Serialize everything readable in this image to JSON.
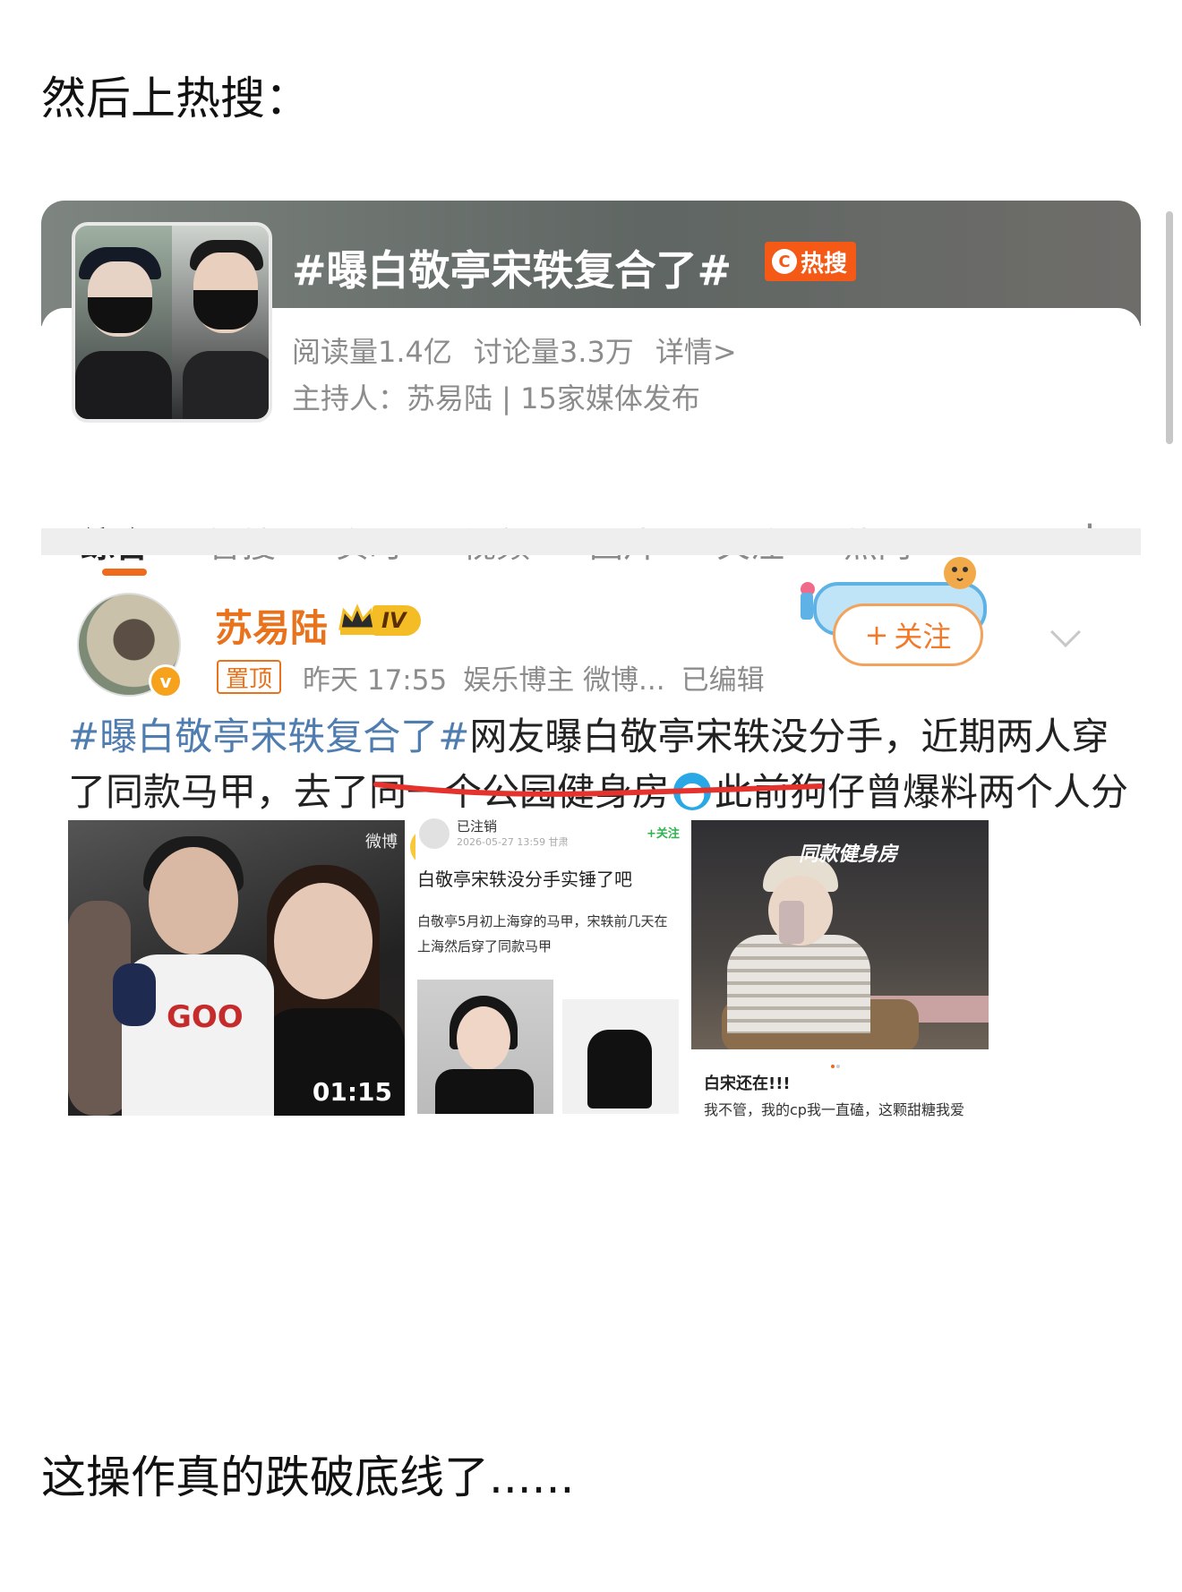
{
  "captions": {
    "top": "然后上热搜：",
    "bottom": "这操作真的跌破底线了......"
  },
  "topic": {
    "title": "#曝白敬亭宋轶复合了#",
    "hot_label": "热搜",
    "reads": "阅读量1.4亿",
    "discussions": "讨论量3.3万",
    "details_link": "详情>",
    "host_line": "主持人：苏易陆 | 15家媒体发布"
  },
  "tabs": [
    {
      "label": "综合",
      "active": true
    },
    {
      "label": "智搜",
      "active": false
    },
    {
      "label": "实时",
      "active": false
    },
    {
      "label": "视频",
      "active": false
    },
    {
      "label": "图片",
      "active": false
    },
    {
      "label": "关注",
      "active": false
    },
    {
      "label": "热门",
      "active": false
    }
  ],
  "post": {
    "author": "苏易陆",
    "level": "IV",
    "pinned_label": "置顶",
    "time": "昨天 17:55",
    "category": "娱乐博主 微博...",
    "edited": "已编辑",
    "follow_label": "关注",
    "text_hashtag": "#曝白敬亭宋轶复合了#",
    "text_part1": "网友曝白敬亭宋轶没分手，近期两人穿了同款马甲，",
    "text_part2": "去了同一个公园健身房",
    "text_part3": "此前狗仔曾爆料两个人分手了，这是复合了吗"
  },
  "media": {
    "video_duration": "01:15",
    "video_watermark": "微博",
    "screenshot": {
      "user": "已注销",
      "date": "2026-05-27 13:59 甘肃",
      "follow": "+关注",
      "title": "白敬亭宋轶没分手实锤了吧",
      "body_line1": "白敬亭5月初上海穿的马甲，宋轶前几天在",
      "body_line2": "上海然后穿了同款马甲"
    },
    "gym": {
      "label": "同款健身房",
      "caption1": "白宋还在!!!",
      "caption2": "我不管，我的cp我一直磕，这颗甜糖我爱"
    }
  },
  "colors": {
    "accent_orange": "#f06a1c",
    "hashtag_blue": "#507daf",
    "username_orange": "#e8731c"
  }
}
